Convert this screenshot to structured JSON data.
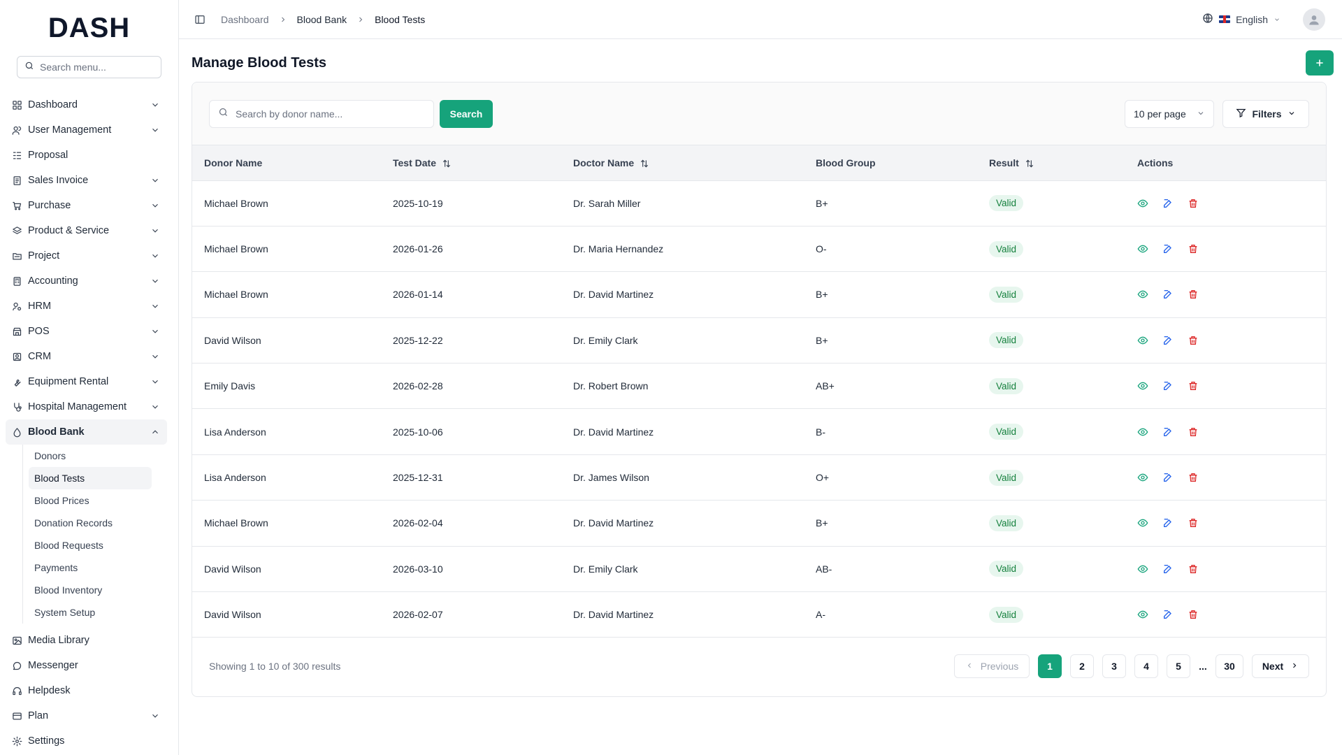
{
  "brand": {
    "logo": "DASH",
    "accent": "#16a37b"
  },
  "sidebar": {
    "search_placeholder": "Search menu...",
    "items": [
      {
        "label": "Dashboard",
        "icon": "grid-icon",
        "expandable": true
      },
      {
        "label": "User Management",
        "icon": "users-icon",
        "expandable": true
      },
      {
        "label": "Proposal",
        "icon": "proposal-icon",
        "expandable": false
      },
      {
        "label": "Sales Invoice",
        "icon": "invoice-icon",
        "expandable": true
      },
      {
        "label": "Purchase",
        "icon": "cart-icon",
        "expandable": true
      },
      {
        "label": "Product & Service",
        "icon": "layers-icon",
        "expandable": true
      },
      {
        "label": "Project",
        "icon": "folder-icon",
        "expandable": true
      },
      {
        "label": "Accounting",
        "icon": "calculator-icon",
        "expandable": true
      },
      {
        "label": "HRM",
        "icon": "hrm-icon",
        "expandable": true
      },
      {
        "label": "POS",
        "icon": "store-icon",
        "expandable": true
      },
      {
        "label": "CRM",
        "icon": "crm-icon",
        "expandable": true
      },
      {
        "label": "Equipment Rental",
        "icon": "wrench-icon",
        "expandable": true
      },
      {
        "label": "Hospital Management",
        "icon": "stethoscope-icon",
        "expandable": true
      },
      {
        "label": "Blood Bank",
        "icon": "droplet-icon",
        "expandable": true,
        "open": true
      },
      {
        "label": "Media Library",
        "icon": "image-icon",
        "expandable": false
      },
      {
        "label": "Messenger",
        "icon": "chat-icon",
        "expandable": false
      },
      {
        "label": "Helpdesk",
        "icon": "headset-icon",
        "expandable": false
      },
      {
        "label": "Plan",
        "icon": "card-icon",
        "expandable": true
      },
      {
        "label": "Settings",
        "icon": "gear-icon",
        "expandable": false
      }
    ],
    "blood_bank_sub": [
      "Donors",
      "Blood Tests",
      "Blood Prices",
      "Donation Records",
      "Blood Requests",
      "Payments",
      "Blood Inventory",
      "System Setup"
    ],
    "active_sub": "Blood Tests"
  },
  "topbar": {
    "breadcrumb": [
      "Dashboard",
      "Blood Bank",
      "Blood Tests"
    ],
    "language": "English"
  },
  "page": {
    "title": "Manage Blood Tests",
    "search_placeholder": "Search by donor name...",
    "search_label": "Search",
    "per_page": "10 per page",
    "filters_label": "Filters"
  },
  "table": {
    "columns": [
      "Donor Name",
      "Test Date",
      "Doctor Name",
      "Blood Group",
      "Result",
      "Actions"
    ],
    "sortable": [
      false,
      true,
      true,
      false,
      true,
      false
    ],
    "rows": [
      {
        "donor": "Michael Brown",
        "date": "2025-10-19",
        "doctor": "Dr. Sarah Miller",
        "group": "B+",
        "result": "Valid"
      },
      {
        "donor": "Michael Brown",
        "date": "2026-01-26",
        "doctor": "Dr. Maria Hernandez",
        "group": "O-",
        "result": "Valid"
      },
      {
        "donor": "Michael Brown",
        "date": "2026-01-14",
        "doctor": "Dr. David Martinez",
        "group": "B+",
        "result": "Valid"
      },
      {
        "donor": "David Wilson",
        "date": "2025-12-22",
        "doctor": "Dr. Emily Clark",
        "group": "B+",
        "result": "Valid"
      },
      {
        "donor": "Emily Davis",
        "date": "2026-02-28",
        "doctor": "Dr. Robert Brown",
        "group": "AB+",
        "result": "Valid"
      },
      {
        "donor": "Lisa Anderson",
        "date": "2025-10-06",
        "doctor": "Dr. David Martinez",
        "group": "B-",
        "result": "Valid"
      },
      {
        "donor": "Lisa Anderson",
        "date": "2025-12-31",
        "doctor": "Dr. James Wilson",
        "group": "O+",
        "result": "Valid"
      },
      {
        "donor": "Michael Brown",
        "date": "2026-02-04",
        "doctor": "Dr. David Martinez",
        "group": "B+",
        "result": "Valid"
      },
      {
        "donor": "David Wilson",
        "date": "2026-03-10",
        "doctor": "Dr. Emily Clark",
        "group": "AB-",
        "result": "Valid"
      },
      {
        "donor": "David Wilson",
        "date": "2026-02-07",
        "doctor": "Dr. David Martinez",
        "group": "A-",
        "result": "Valid"
      }
    ]
  },
  "pagination": {
    "showing": "Showing 1 to 10 of 300 results",
    "previous": "Previous",
    "next": "Next",
    "pages": [
      "1",
      "2",
      "3",
      "4",
      "5"
    ],
    "ellipsis": "...",
    "last": "30",
    "current": "1"
  }
}
